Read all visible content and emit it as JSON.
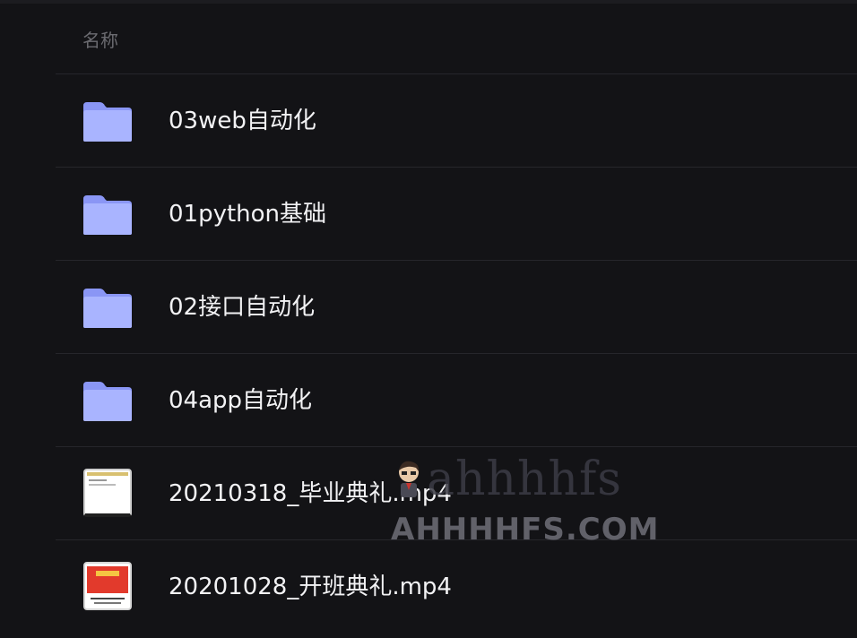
{
  "header": {
    "name_label": "名称"
  },
  "files": [
    {
      "name": "03web自动化",
      "type": "folder",
      "icon": "folder-icon"
    },
    {
      "name": "01python基础",
      "type": "folder",
      "icon": "folder-icon"
    },
    {
      "name": "02接口自动化",
      "type": "folder",
      "icon": "folder-icon"
    },
    {
      "name": "04app自动化",
      "type": "folder",
      "icon": "folder-icon"
    },
    {
      "name": "20210318_毕业典礼.mp4",
      "type": "video",
      "icon": "video-thumbnail"
    },
    {
      "name": "20201028_开班典礼.mp4",
      "type": "video",
      "icon": "video-thumbnail"
    }
  ],
  "watermark": {
    "brand": "ahhhhfs",
    "domain": "AHHHHFS.COM"
  },
  "colors": {
    "background": "#131316",
    "divider": "#26262b",
    "folder_light": "#a9b4ff",
    "folder_dark": "#8a96f5",
    "text": "#f2f2f4",
    "header_text": "#6b6b70"
  }
}
